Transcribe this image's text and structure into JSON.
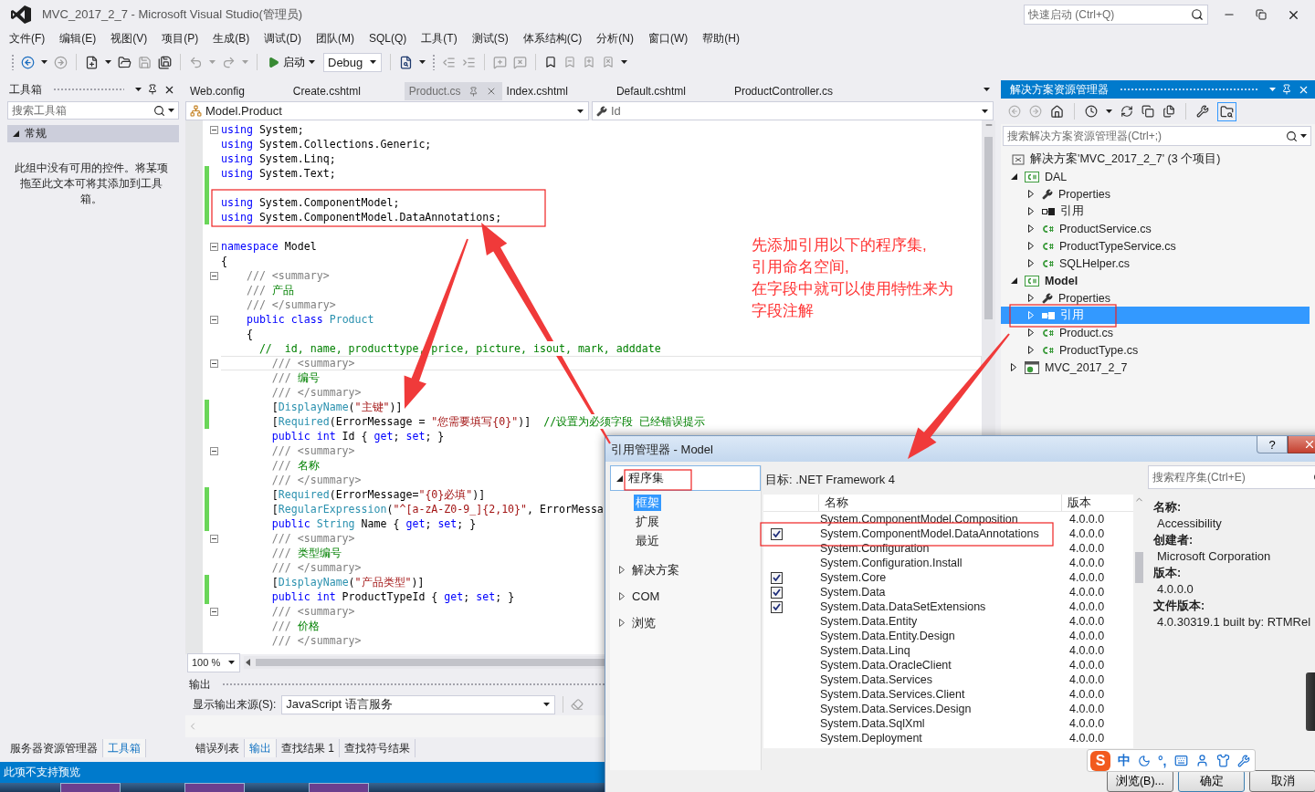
{
  "window": {
    "title": "MVC_2017_2_7 - Microsoft Visual Studio(管理员)",
    "quick_launch": {
      "placeholder": "快速启动 (Ctrl+Q)"
    }
  },
  "menu": [
    "文件(F)",
    "编辑(E)",
    "视图(V)",
    "项目(P)",
    "生成(B)",
    "调试(D)",
    "团队(M)",
    "SQL(Q)",
    "工具(T)",
    "测试(S)",
    "体系结构(C)",
    "分析(N)",
    "窗口(W)",
    "帮助(H)"
  ],
  "toolbar": {
    "start_label": "启动",
    "configuration": "Debug"
  },
  "toolbox": {
    "title": "工具箱",
    "search": {
      "placeholder": "搜索工具箱"
    },
    "group": {
      "label": "常规",
      "expanded": true
    },
    "empty_message": "此组中没有可用的控件。将某项拖至此文本可将其添加到工具箱。"
  },
  "editor": {
    "tabs": [
      {
        "label": "Web.config",
        "selected": false
      },
      {
        "label": "Create.cshtml",
        "selected": false
      },
      {
        "label": "Product.cs",
        "selected": true
      },
      {
        "label": "Index.cshtml",
        "selected": false
      },
      {
        "label": "Default.cshtml",
        "selected": false
      },
      {
        "label": "ProductController.cs",
        "selected": false
      }
    ],
    "type_dropdown": "Model.Product",
    "member_dropdown": "Id",
    "zoom": "100 %",
    "lines": [
      {
        "changed": false,
        "fold": true,
        "segments": [
          {
            "kind": "kw",
            "text": "using"
          },
          {
            "kind": "plain",
            "text": " System;"
          }
        ]
      },
      {
        "changed": false,
        "fold": false,
        "segments": [
          {
            "kind": "kw",
            "text": "using"
          },
          {
            "kind": "plain",
            "text": " System.Collections.Generic;"
          }
        ]
      },
      {
        "changed": false,
        "fold": false,
        "segments": [
          {
            "kind": "kw",
            "text": "using"
          },
          {
            "kind": "plain",
            "text": " System.Linq;"
          }
        ]
      },
      {
        "changed": true,
        "fold": false,
        "segments": [
          {
            "kind": "kw",
            "text": "using"
          },
          {
            "kind": "plain",
            "text": " System.Text;"
          }
        ]
      },
      {
        "changed": true,
        "fold": false
      },
      {
        "changed": true,
        "fold": false,
        "segments": [
          {
            "kind": "kw",
            "text": "using"
          },
          {
            "kind": "plain",
            "text": " System.ComponentModel;"
          }
        ]
      },
      {
        "changed": true,
        "fold": false,
        "segments": [
          {
            "kind": "kw",
            "text": "using"
          },
          {
            "kind": "plain",
            "text": " System.ComponentModel.DataAnnotations;"
          }
        ]
      },
      {
        "changed": false,
        "fold": false
      },
      {
        "changed": false,
        "fold": true,
        "segments": [
          {
            "kind": "kw",
            "text": "namespace"
          },
          {
            "kind": "plain",
            "text": " Model"
          }
        ]
      },
      {
        "changed": false,
        "fold": false,
        "segments": [
          {
            "kind": "plain",
            "text": "{"
          }
        ]
      },
      {
        "changed": false,
        "fold": true,
        "segments": [
          {
            "kind": "doc",
            "text": "    /// <summary>"
          }
        ]
      },
      {
        "changed": false,
        "fold": false,
        "segments": [
          {
            "kind": "doc",
            "text": "    /// "
          },
          {
            "kind": "comment",
            "text": "产品"
          }
        ]
      },
      {
        "changed": false,
        "fold": false,
        "segments": [
          {
            "kind": "doc",
            "text": "    /// </summary>"
          }
        ]
      },
      {
        "changed": false,
        "fold": true,
        "segments": [
          {
            "kind": "kw",
            "text": "    public class"
          },
          {
            "kind": "type",
            "text": " Product"
          }
        ]
      },
      {
        "changed": false,
        "fold": false,
        "segments": [
          {
            "kind": "plain",
            "text": "    {"
          }
        ]
      },
      {
        "changed": false,
        "fold": false,
        "segments": [
          {
            "kind": "comment",
            "text": "      //  id, name, producttype, price, picture, isout, mark, adddate"
          }
        ]
      },
      {
        "changed": false,
        "fold": true,
        "current": true,
        "segments": [
          {
            "kind": "doc",
            "text": "        /// <summary>"
          }
        ]
      },
      {
        "changed": false,
        "fold": false,
        "segments": [
          {
            "kind": "doc",
            "text": "        /// "
          },
          {
            "kind": "comment",
            "text": "编号"
          }
        ]
      },
      {
        "changed": false,
        "fold": false,
        "segments": [
          {
            "kind": "doc",
            "text": "        /// </summary>"
          }
        ]
      },
      {
        "changed": true,
        "fold": false,
        "segments": [
          {
            "kind": "plain",
            "text": "        ["
          },
          {
            "kind": "type",
            "text": "DisplayName"
          },
          {
            "kind": "plain",
            "text": "("
          },
          {
            "kind": "str",
            "text": "\"主键\""
          },
          {
            "kind": "plain",
            "text": ")]"
          }
        ]
      },
      {
        "changed": true,
        "fold": false,
        "segments": [
          {
            "kind": "plain",
            "text": "        ["
          },
          {
            "kind": "type",
            "text": "Required"
          },
          {
            "kind": "plain",
            "text": "(ErrorMessage = "
          },
          {
            "kind": "str",
            "text": "\"您需要填写{0}\""
          },
          {
            "kind": "plain",
            "text": ")]  "
          },
          {
            "kind": "comment",
            "text": "//设置为必须字段 已经错误提示"
          }
        ]
      },
      {
        "changed": false,
        "fold": false,
        "segments": [
          {
            "kind": "kw",
            "text": "        public int"
          },
          {
            "kind": "plain",
            "text": " Id { "
          },
          {
            "kind": "kw",
            "text": "get"
          },
          {
            "kind": "plain",
            "text": "; "
          },
          {
            "kind": "kw",
            "text": "set"
          },
          {
            "kind": "plain",
            "text": "; }"
          }
        ]
      },
      {
        "changed": false,
        "fold": true,
        "segments": [
          {
            "kind": "doc",
            "text": "        /// <summary>"
          }
        ]
      },
      {
        "changed": false,
        "fold": false,
        "segments": [
          {
            "kind": "doc",
            "text": "        /// "
          },
          {
            "kind": "comment",
            "text": "名称"
          }
        ]
      },
      {
        "changed": false,
        "fold": false,
        "segments": [
          {
            "kind": "doc",
            "text": "        /// </summary>"
          }
        ]
      },
      {
        "changed": true,
        "fold": false,
        "segments": [
          {
            "kind": "plain",
            "text": "        ["
          },
          {
            "kind": "type",
            "text": "Required"
          },
          {
            "kind": "plain",
            "text": "(ErrorMessage="
          },
          {
            "kind": "str",
            "text": "\"{0}必填\""
          },
          {
            "kind": "plain",
            "text": ")]"
          }
        ]
      },
      {
        "changed": true,
        "fold": false,
        "segments": [
          {
            "kind": "plain",
            "text": "        ["
          },
          {
            "kind": "type",
            "text": "RegularExpression"
          },
          {
            "kind": "plain",
            "text": "("
          },
          {
            "kind": "str",
            "text": "\"^[a-zA-Z0-9_]{2,10}\""
          },
          {
            "kind": "plain",
            "text": ", ErrorMessa"
          }
        ]
      },
      {
        "changed": true,
        "fold": false,
        "segments": [
          {
            "kind": "kw",
            "text": "        public"
          },
          {
            "kind": "type",
            "text": " String"
          },
          {
            "kind": "plain",
            "text": " Name { "
          },
          {
            "kind": "kw",
            "text": "get"
          },
          {
            "kind": "plain",
            "text": "; "
          },
          {
            "kind": "kw",
            "text": "set"
          },
          {
            "kind": "plain",
            "text": "; }"
          }
        ]
      },
      {
        "changed": false,
        "fold": true,
        "segments": [
          {
            "kind": "doc",
            "text": "        /// <summary>"
          }
        ]
      },
      {
        "changed": false,
        "fold": false,
        "segments": [
          {
            "kind": "doc",
            "text": "        /// "
          },
          {
            "kind": "comment",
            "text": "类型编号"
          }
        ]
      },
      {
        "changed": false,
        "fold": false,
        "segments": [
          {
            "kind": "doc",
            "text": "        /// </summary>"
          }
        ]
      },
      {
        "changed": true,
        "fold": false,
        "segments": [
          {
            "kind": "plain",
            "text": "        ["
          },
          {
            "kind": "type",
            "text": "DisplayName"
          },
          {
            "kind": "plain",
            "text": "("
          },
          {
            "kind": "str",
            "text": "\"产品类型\""
          },
          {
            "kind": "plain",
            "text": ")]"
          }
        ]
      },
      {
        "changed": true,
        "fold": false,
        "segments": [
          {
            "kind": "kw",
            "text": "        public int"
          },
          {
            "kind": "plain",
            "text": " ProductTypeId { "
          },
          {
            "kind": "kw",
            "text": "get"
          },
          {
            "kind": "plain",
            "text": "; "
          },
          {
            "kind": "kw",
            "text": "set"
          },
          {
            "kind": "plain",
            "text": "; }"
          }
        ]
      },
      {
        "changed": false,
        "fold": true,
        "segments": [
          {
            "kind": "doc",
            "text": "        /// <summary>"
          }
        ]
      },
      {
        "changed": false,
        "fold": false,
        "segments": [
          {
            "kind": "doc",
            "text": "        /// "
          },
          {
            "kind": "comment",
            "text": "价格"
          }
        ]
      },
      {
        "changed": false,
        "fold": false,
        "segments": [
          {
            "kind": "doc",
            "text": "        /// </summary>"
          }
        ]
      }
    ]
  },
  "output": {
    "title": "输出",
    "source_label": "显示输出来源(S):",
    "source": "JavaScript 语言服务"
  },
  "bottom_tabs_left": [
    {
      "label": "服务器资源管理器",
      "selected": false
    },
    {
      "label": "工具箱",
      "selected": true
    }
  ],
  "bottom_tabs_right": [
    {
      "label": "错误列表",
      "selected": false
    },
    {
      "label": "输出",
      "selected": true
    },
    {
      "label": "查找结果 1",
      "selected": false
    },
    {
      "label": "查找符号结果",
      "selected": false
    }
  ],
  "status_bar": {
    "text": "此项不支持预览"
  },
  "solution_explorer": {
    "title": "解决方案资源管理器",
    "search": {
      "placeholder": "搜索解决方案资源管理器(Ctrl+;)"
    },
    "tree": [
      {
        "label": "解决方案'MVC_2017_2_7' (3 个项目)",
        "kind": "solution",
        "selected": false,
        "children": [
          {
            "label": "DAL",
            "kind": "project",
            "expanded": true,
            "bold": false,
            "selected": false,
            "children": [
              {
                "label": "Properties",
                "kind": "properties",
                "expanded": false,
                "selected": false
              },
              {
                "label": "引用",
                "kind": "references",
                "expanded": false,
                "selected": false
              },
              {
                "label": "ProductService.cs",
                "kind": "csharp",
                "expanded": false,
                "selected": false
              },
              {
                "label": "ProductTypeService.cs",
                "kind": "csharp",
                "expanded": false,
                "selected": false
              },
              {
                "label": "SQLHelper.cs",
                "kind": "csharp",
                "expanded": false,
                "selected": false
              }
            ]
          },
          {
            "label": "Model",
            "kind": "project",
            "expanded": true,
            "bold": true,
            "selected": false,
            "children": [
              {
                "label": "Properties",
                "kind": "properties",
                "expanded": false,
                "selected": false
              },
              {
                "label": "引用",
                "kind": "references",
                "expanded": false,
                "selected": true
              },
              {
                "label": "Product.cs",
                "kind": "csharp",
                "expanded": false,
                "selected": false
              },
              {
                "label": "ProductType.cs",
                "kind": "csharp",
                "expanded": false,
                "selected": false
              }
            ]
          },
          {
            "label": "MVC_2017_2_7",
            "kind": "web_project",
            "expanded": false,
            "bold": false,
            "selected": false
          }
        ]
      }
    ]
  },
  "annotation": [
    "先添加引用以下的程序集,",
    "引用命名空间,",
    "在字段中就可以使用特性来为",
    "字段注解"
  ],
  "dialog": {
    "title": "引用管理器 - Model",
    "help_label": "?",
    "nav": [
      {
        "label": "程序集",
        "expanded": true,
        "children": [
          {
            "label": "框架",
            "selected": true
          },
          {
            "label": "扩展",
            "selected": false
          },
          {
            "label": "最近",
            "selected": false
          }
        ]
      },
      {
        "label": "解决方案",
        "expanded": false
      },
      {
        "label": "COM",
        "expanded": false
      },
      {
        "label": "浏览",
        "expanded": false
      }
    ],
    "target": "目标: .NET Framework 4",
    "search": {
      "placeholder": "搜索程序集(Ctrl+E)"
    },
    "columns": [
      "名称",
      "版本"
    ],
    "assemblies": [
      {
        "name": "System.ComponentModel.Composition",
        "version": "4.0.0.0",
        "checked": false
      },
      {
        "name": "System.ComponentModel.DataAnnotations",
        "version": "4.0.0.0",
        "checked": true
      },
      {
        "name": "System.Configuration",
        "version": "4.0.0.0",
        "checked": false
      },
      {
        "name": "System.Configuration.Install",
        "version": "4.0.0.0",
        "checked": false
      },
      {
        "name": "System.Core",
        "version": "4.0.0.0",
        "checked": true
      },
      {
        "name": "System.Data",
        "version": "4.0.0.0",
        "checked": true
      },
      {
        "name": "System.Data.DataSetExtensions",
        "version": "4.0.0.0",
        "checked": true
      },
      {
        "name": "System.Data.Entity",
        "version": "4.0.0.0",
        "checked": false
      },
      {
        "name": "System.Data.Entity.Design",
        "version": "4.0.0.0",
        "checked": false
      },
      {
        "name": "System.Data.Linq",
        "version": "4.0.0.0",
        "checked": false
      },
      {
        "name": "System.Data.OracleClient",
        "version": "4.0.0.0",
        "checked": false
      },
      {
        "name": "System.Data.Services",
        "version": "4.0.0.0",
        "checked": false
      },
      {
        "name": "System.Data.Services.Client",
        "version": "4.0.0.0",
        "checked": false
      },
      {
        "name": "System.Data.Services.Design",
        "version": "4.0.0.0",
        "checked": false
      },
      {
        "name": "System.Data.SqlXml",
        "version": "4.0.0.0",
        "checked": false
      },
      {
        "name": "System.Deployment",
        "version": "4.0.0.0",
        "checked": false
      }
    ],
    "details": [
      {
        "label": "名称:",
        "value": "Accessibility"
      },
      {
        "label": "创建者:",
        "value": "Microsoft Corporation"
      },
      {
        "label": "版本:",
        "value": "4.0.0.0"
      },
      {
        "label": "文件版本:",
        "value": "4.0.30319.1 built by: RTMRel"
      }
    ],
    "buttons": [
      "浏览(B)...",
      "确定",
      "取消"
    ]
  },
  "ime": {
    "logo": "S",
    "mode": "中",
    "punctuation": "°,"
  }
}
